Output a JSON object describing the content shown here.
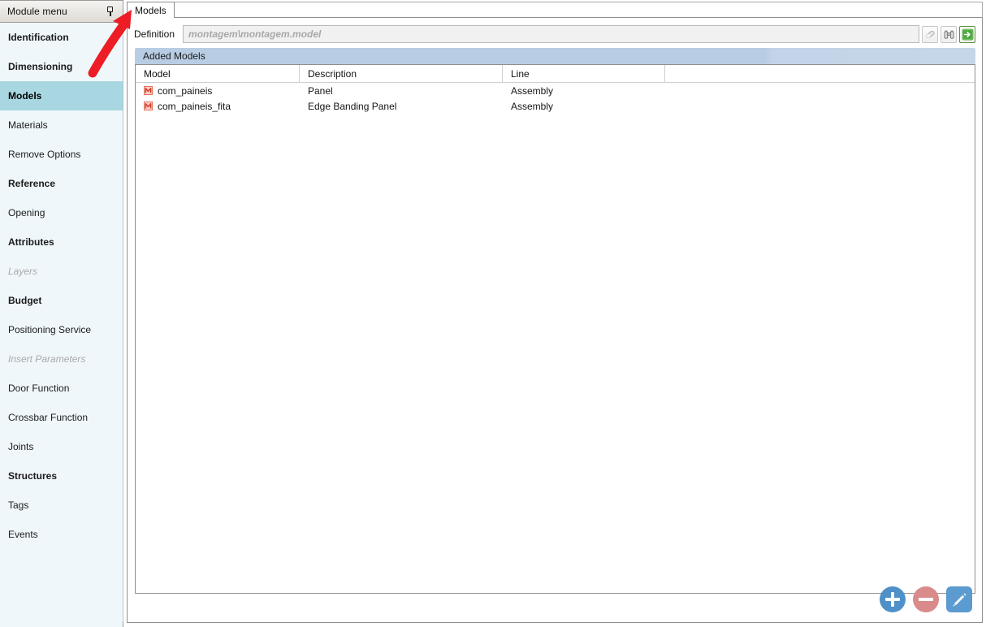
{
  "sidebar": {
    "header_title": "Module menu",
    "pin_icon": "pin-icon",
    "items": [
      {
        "label": "Identification",
        "style": "bold"
      },
      {
        "label": "Dimensioning",
        "style": "bold"
      },
      {
        "label": "Models",
        "style": "active"
      },
      {
        "label": "Materials",
        "style": "normal"
      },
      {
        "label": "Remove Options",
        "style": "normal"
      },
      {
        "label": "Reference",
        "style": "bold"
      },
      {
        "label": "Opening",
        "style": "normal"
      },
      {
        "label": "Attributes",
        "style": "bold"
      },
      {
        "label": "Layers",
        "style": "dim"
      },
      {
        "label": "Budget",
        "style": "bold"
      },
      {
        "label": "Positioning Service",
        "style": "normal"
      },
      {
        "label": "Insert Parameters",
        "style": "dim"
      },
      {
        "label": "Door Function",
        "style": "normal"
      },
      {
        "label": "Crossbar Function",
        "style": "normal"
      },
      {
        "label": "Joints",
        "style": "normal"
      },
      {
        "label": "Structures",
        "style": "bold"
      },
      {
        "label": "Tags",
        "style": "normal"
      },
      {
        "label": "Events",
        "style": "normal"
      }
    ]
  },
  "tabs": {
    "active_tab": "Models"
  },
  "definition": {
    "label": "Definition",
    "value": "montagem\\montagem.model",
    "placeholder": "montagem\\montagem.model",
    "buttons": [
      {
        "name": "eraser-icon",
        "title": "Clear"
      },
      {
        "name": "binoculars-icon",
        "title": "Browse"
      },
      {
        "name": "green-arrow-icon",
        "title": "Go"
      }
    ]
  },
  "section": {
    "title": "Added Models"
  },
  "table": {
    "columns": [
      "Model",
      "Description",
      "Line"
    ],
    "rows": [
      {
        "model": "com_paineis",
        "description": "Panel",
        "line": "Assembly",
        "icon": "model-m-icon"
      },
      {
        "model": "com_paineis_fita",
        "description": "Edge Banding Panel",
        "line": "Assembly",
        "icon": "model-m-icon"
      }
    ]
  },
  "actions": [
    {
      "name": "add-button",
      "icon": "plus-icon",
      "color": "#4e90c8"
    },
    {
      "name": "remove-button",
      "icon": "minus-icon",
      "color": "#d98b8b"
    },
    {
      "name": "edit-button",
      "icon": "pencil-icon",
      "color": "#5b9bd0"
    }
  ],
  "annotation": {
    "arrow_color": "#ee1c25",
    "points_to": "Models"
  }
}
